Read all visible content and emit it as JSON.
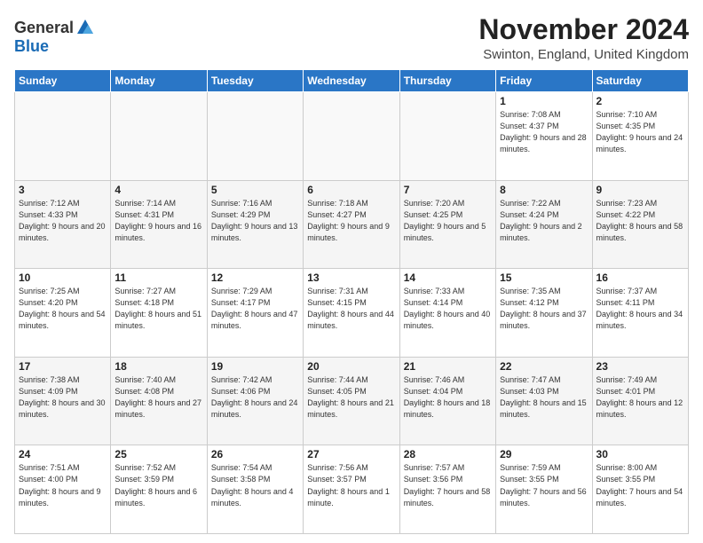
{
  "logo": {
    "line1": "General",
    "line2": "Blue"
  },
  "title": "November 2024",
  "location": "Swinton, England, United Kingdom",
  "days_header": [
    "Sunday",
    "Monday",
    "Tuesday",
    "Wednesday",
    "Thursday",
    "Friday",
    "Saturday"
  ],
  "weeks": [
    [
      {
        "day": "",
        "info": ""
      },
      {
        "day": "",
        "info": ""
      },
      {
        "day": "",
        "info": ""
      },
      {
        "day": "",
        "info": ""
      },
      {
        "day": "",
        "info": ""
      },
      {
        "day": "1",
        "info": "Sunrise: 7:08 AM\nSunset: 4:37 PM\nDaylight: 9 hours\nand 28 minutes."
      },
      {
        "day": "2",
        "info": "Sunrise: 7:10 AM\nSunset: 4:35 PM\nDaylight: 9 hours\nand 24 minutes."
      }
    ],
    [
      {
        "day": "3",
        "info": "Sunrise: 7:12 AM\nSunset: 4:33 PM\nDaylight: 9 hours\nand 20 minutes."
      },
      {
        "day": "4",
        "info": "Sunrise: 7:14 AM\nSunset: 4:31 PM\nDaylight: 9 hours\nand 16 minutes."
      },
      {
        "day": "5",
        "info": "Sunrise: 7:16 AM\nSunset: 4:29 PM\nDaylight: 9 hours\nand 13 minutes."
      },
      {
        "day": "6",
        "info": "Sunrise: 7:18 AM\nSunset: 4:27 PM\nDaylight: 9 hours\nand 9 minutes."
      },
      {
        "day": "7",
        "info": "Sunrise: 7:20 AM\nSunset: 4:25 PM\nDaylight: 9 hours\nand 5 minutes."
      },
      {
        "day": "8",
        "info": "Sunrise: 7:22 AM\nSunset: 4:24 PM\nDaylight: 9 hours\nand 2 minutes."
      },
      {
        "day": "9",
        "info": "Sunrise: 7:23 AM\nSunset: 4:22 PM\nDaylight: 8 hours\nand 58 minutes."
      }
    ],
    [
      {
        "day": "10",
        "info": "Sunrise: 7:25 AM\nSunset: 4:20 PM\nDaylight: 8 hours\nand 54 minutes."
      },
      {
        "day": "11",
        "info": "Sunrise: 7:27 AM\nSunset: 4:18 PM\nDaylight: 8 hours\nand 51 minutes."
      },
      {
        "day": "12",
        "info": "Sunrise: 7:29 AM\nSunset: 4:17 PM\nDaylight: 8 hours\nand 47 minutes."
      },
      {
        "day": "13",
        "info": "Sunrise: 7:31 AM\nSunset: 4:15 PM\nDaylight: 8 hours\nand 44 minutes."
      },
      {
        "day": "14",
        "info": "Sunrise: 7:33 AM\nSunset: 4:14 PM\nDaylight: 8 hours\nand 40 minutes."
      },
      {
        "day": "15",
        "info": "Sunrise: 7:35 AM\nSunset: 4:12 PM\nDaylight: 8 hours\nand 37 minutes."
      },
      {
        "day": "16",
        "info": "Sunrise: 7:37 AM\nSunset: 4:11 PM\nDaylight: 8 hours\nand 34 minutes."
      }
    ],
    [
      {
        "day": "17",
        "info": "Sunrise: 7:38 AM\nSunset: 4:09 PM\nDaylight: 8 hours\nand 30 minutes."
      },
      {
        "day": "18",
        "info": "Sunrise: 7:40 AM\nSunset: 4:08 PM\nDaylight: 8 hours\nand 27 minutes."
      },
      {
        "day": "19",
        "info": "Sunrise: 7:42 AM\nSunset: 4:06 PM\nDaylight: 8 hours\nand 24 minutes."
      },
      {
        "day": "20",
        "info": "Sunrise: 7:44 AM\nSunset: 4:05 PM\nDaylight: 8 hours\nand 21 minutes."
      },
      {
        "day": "21",
        "info": "Sunrise: 7:46 AM\nSunset: 4:04 PM\nDaylight: 8 hours\nand 18 minutes."
      },
      {
        "day": "22",
        "info": "Sunrise: 7:47 AM\nSunset: 4:03 PM\nDaylight: 8 hours\nand 15 minutes."
      },
      {
        "day": "23",
        "info": "Sunrise: 7:49 AM\nSunset: 4:01 PM\nDaylight: 8 hours\nand 12 minutes."
      }
    ],
    [
      {
        "day": "24",
        "info": "Sunrise: 7:51 AM\nSunset: 4:00 PM\nDaylight: 8 hours\nand 9 minutes."
      },
      {
        "day": "25",
        "info": "Sunrise: 7:52 AM\nSunset: 3:59 PM\nDaylight: 8 hours\nand 6 minutes."
      },
      {
        "day": "26",
        "info": "Sunrise: 7:54 AM\nSunset: 3:58 PM\nDaylight: 8 hours\nand 4 minutes."
      },
      {
        "day": "27",
        "info": "Sunrise: 7:56 AM\nSunset: 3:57 PM\nDaylight: 8 hours\nand 1 minute."
      },
      {
        "day": "28",
        "info": "Sunrise: 7:57 AM\nSunset: 3:56 PM\nDaylight: 7 hours\nand 58 minutes."
      },
      {
        "day": "29",
        "info": "Sunrise: 7:59 AM\nSunset: 3:55 PM\nDaylight: 7 hours\nand 56 minutes."
      },
      {
        "day": "30",
        "info": "Sunrise: 8:00 AM\nSunset: 3:55 PM\nDaylight: 7 hours\nand 54 minutes."
      }
    ]
  ]
}
